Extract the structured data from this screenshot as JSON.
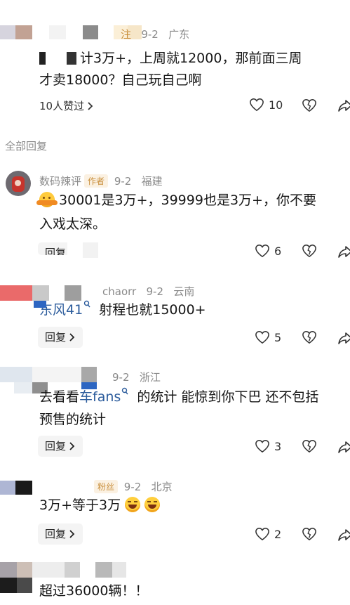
{
  "top_comment": {
    "tag": "注",
    "date": "9-2",
    "location": "广东",
    "text_line1": "计3万+，上周就12000，那前面三周",
    "text_line2": "才卖18000？自己玩自己啊",
    "liked_by": "10人赞过",
    "likes": "10"
  },
  "section_title": "全部回复",
  "replies": [
    {
      "username": "数码辣评",
      "badge": "作者",
      "date": "9-2",
      "location": "福建",
      "text_line1": "30001是3万+，39999也是3万+，你不要",
      "text_line2": "入戏太深。",
      "reply_label": "回复",
      "likes": "6"
    },
    {
      "username": "chaorr",
      "date": "9-2",
      "location": "云南",
      "mention": "东风41",
      "text": "射程也就15000+",
      "reply_label": "回复",
      "likes": "5"
    },
    {
      "date": "9-2",
      "location": "浙江",
      "text_prefix": "去看看",
      "mention": "车fans",
      "text_line1": "的统计 能惊到你下巴 还不包括",
      "text_line2": "预售的统计",
      "reply_label": "回复",
      "likes": "3"
    },
    {
      "badge": "粉丝",
      "date": "9-2",
      "location": "北京",
      "text": "3万+等于3万",
      "reply_label": "回复",
      "likes": "2"
    },
    {
      "text": "超过36000辆！！"
    }
  ],
  "icons": {
    "like": "heart-icon",
    "dislike": "broken-heart-icon",
    "share": "share-icon",
    "chevron": "chevron-right-icon",
    "search_mark": "search-icon"
  }
}
